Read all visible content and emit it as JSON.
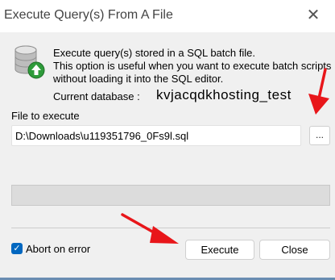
{
  "window": {
    "title": "Execute Query(s) From A File",
    "close_glyph": "✕"
  },
  "info": {
    "icon": "database-upload-icon",
    "line1": "Execute query(s) stored in a SQL batch file.",
    "line2": "This option is useful when you want to execute batch scripts",
    "line3": "without loading it into the SQL editor.",
    "current_db_label": "Current database :",
    "current_db_value": "kvjacqdkhosting_test"
  },
  "file": {
    "label": "File to execute",
    "value": "D:\\Downloads\\u119351796_0Fs9l.sql",
    "browse_label": "..."
  },
  "progress": {
    "value": 0
  },
  "options": {
    "abort_on_error_label": "Abort on error",
    "abort_on_error_checked": true,
    "check_glyph": "✓"
  },
  "buttons": {
    "execute": "Execute",
    "close": "Close"
  },
  "colors": {
    "accent": "#0067c0",
    "annotation_arrow": "#e8161a",
    "progress_track": "#dcdcdc"
  }
}
